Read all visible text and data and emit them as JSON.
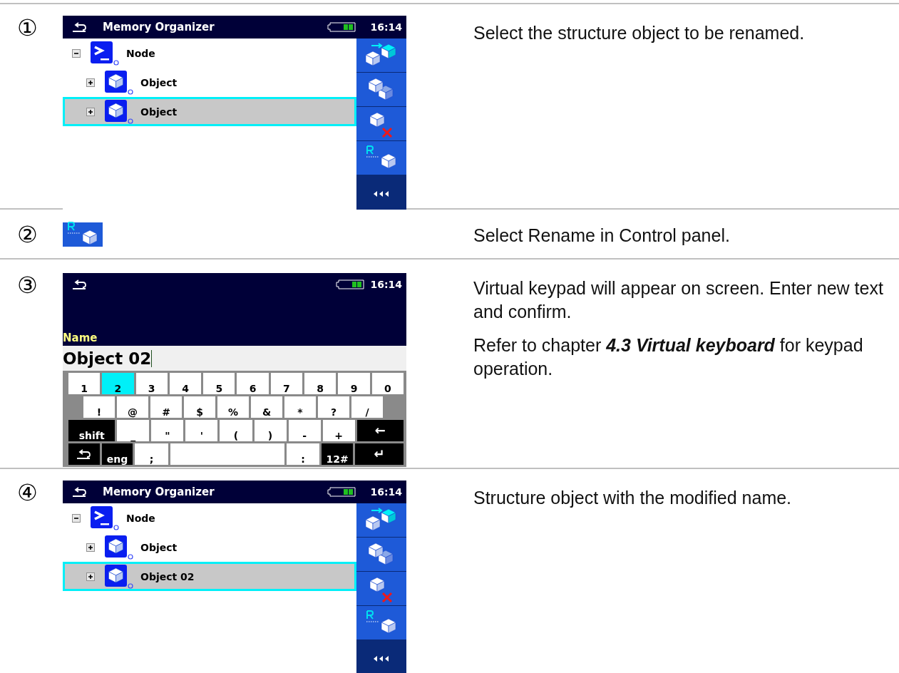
{
  "steps": [
    {
      "number": "①",
      "kind": "tree_screen",
      "screen": {
        "title": "Memory Organizer",
        "time": "16:14",
        "tree": [
          {
            "label": "Node",
            "kind": "node",
            "expanded": true,
            "selected": false,
            "children": [
              {
                "label": "Object",
                "kind": "object",
                "expanded": false,
                "selected": false
              },
              {
                "label": "Object",
                "kind": "object",
                "expanded": false,
                "selected": true
              }
            ]
          }
        ],
        "panel": [
          {
            "kind": "move"
          },
          {
            "kind": "copy"
          },
          {
            "kind": "delete"
          },
          {
            "kind": "rename"
          },
          {
            "kind": "more"
          }
        ]
      },
      "text": [
        "Select the structure object to be renamed."
      ]
    },
    {
      "number": "②",
      "kind": "icon",
      "text": [
        "Select Rename in Control panel."
      ]
    },
    {
      "number": "③",
      "kind": "keyboard_screen",
      "screen": {
        "time": "16:14",
        "field_label": "Name",
        "value": "Object 02",
        "keys": [
          [
            {
              "label": "1",
              "kind": "key",
              "selected": false
            },
            {
              "label": "2",
              "kind": "key",
              "selected": true
            },
            {
              "label": "3",
              "kind": "key",
              "selected": false
            },
            {
              "label": "4",
              "kind": "key",
              "selected": false
            },
            {
              "label": "5",
              "kind": "key",
              "selected": false
            },
            {
              "label": "6",
              "kind": "key",
              "selected": false
            },
            {
              "label": "7",
              "kind": "key",
              "selected": false
            },
            {
              "label": "8",
              "kind": "key",
              "selected": false
            },
            {
              "label": "9",
              "kind": "key",
              "selected": false
            },
            {
              "label": "0",
              "kind": "key",
              "selected": false
            }
          ],
          [
            {
              "label": "!",
              "kind": "key",
              "selected": false
            },
            {
              "label": "@",
              "kind": "key",
              "selected": false
            },
            {
              "label": "#",
              "kind": "key",
              "selected": false
            },
            {
              "label": "$",
              "kind": "key",
              "selected": false
            },
            {
              "label": "%",
              "kind": "key",
              "selected": false
            },
            {
              "label": "&",
              "kind": "key",
              "selected": false
            },
            {
              "label": "*",
              "kind": "key",
              "selected": false
            },
            {
              "label": "?",
              "kind": "key",
              "selected": false
            },
            {
              "label": "/",
              "kind": "key",
              "selected": false
            }
          ],
          [
            {
              "label": "shift",
              "kind": "wide_dark",
              "selected": false
            },
            {
              "label": "_",
              "kind": "key",
              "selected": false
            },
            {
              "label": "\"",
              "kind": "key",
              "selected": false
            },
            {
              "label": "'",
              "kind": "key",
              "selected": false
            },
            {
              "label": "(",
              "kind": "key",
              "selected": false
            },
            {
              "label": ")",
              "kind": "key",
              "selected": false
            },
            {
              "label": "-",
              "kind": "key",
              "selected": false
            },
            {
              "label": "+",
              "kind": "key",
              "selected": false
            },
            {
              "label": "←",
              "kind": "arrow",
              "selected": false
            }
          ],
          [
            {
              "kind": "back",
              "selected": false
            },
            {
              "label": "eng",
              "kind": "dark",
              "selected": false
            },
            {
              "label": ";",
              "kind": "key",
              "selected": false
            },
            {
              "kind": "space",
              "selected": false
            },
            {
              "label": ":",
              "kind": "key",
              "selected": false
            },
            {
              "label": "12#",
              "kind": "dark",
              "selected": false
            },
            {
              "label": "↵",
              "kind": "arrow",
              "selected": false
            }
          ]
        ]
      },
      "text": [
        "Virtual keypad will appear on screen. Enter new text and confirm.",
        "Refer to chapter **4.3 Virtual keyboard** for keypad operation."
      ]
    },
    {
      "number": "④",
      "kind": "tree_screen",
      "screen": {
        "title": "Memory Organizer",
        "time": "16:14",
        "tree": [
          {
            "label": "Node",
            "kind": "node",
            "expanded": true,
            "selected": false,
            "children": [
              {
                "label": "Object",
                "kind": "object",
                "expanded": false,
                "selected": false
              },
              {
                "label": "Object 02",
                "kind": "object",
                "expanded": false,
                "selected": true
              }
            ]
          }
        ],
        "panel": [
          {
            "kind": "move"
          },
          {
            "kind": "copy"
          },
          {
            "kind": "delete"
          },
          {
            "kind": "rename"
          },
          {
            "kind": "more"
          }
        ]
      },
      "text": [
        "Structure object with the modified name."
      ]
    }
  ]
}
